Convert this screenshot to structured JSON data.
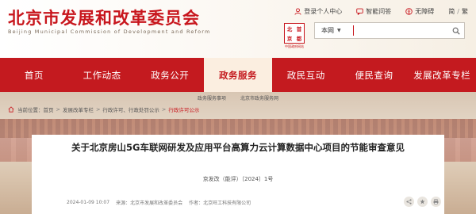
{
  "header": {
    "title": "北京市发展和改革委员会",
    "subtitle": "Beijing Municipal Commission of Development and Reform",
    "top_links": [
      {
        "label": "登录个人中心",
        "icon": "user-icon"
      },
      {
        "label": "智能问答",
        "icon": "chat-icon"
      },
      {
        "label": "无障碍",
        "icon": "accessibility-icon"
      }
    ],
    "lang_simplified": "简",
    "lang_sep": "/",
    "lang_traditional": "繁",
    "seal_chars": [
      "北",
      "首",
      "京",
      "都"
    ],
    "seal_caption": "中国政府网站",
    "search": {
      "scope": "本网",
      "placeholder": "",
      "value": ""
    }
  },
  "nav": {
    "items": [
      {
        "label": "首页"
      },
      {
        "label": "工作动态"
      },
      {
        "label": "政务公开"
      },
      {
        "label": "政务服务",
        "active": true
      },
      {
        "label": "政民互动"
      },
      {
        "label": "便民查询"
      },
      {
        "label": "发展改革专栏"
      }
    ]
  },
  "subnav": {
    "items": [
      "政务服务事项",
      "北京市政务服务网"
    ]
  },
  "breadcrumb": {
    "prefix": "当前位置：",
    "items": [
      "首页",
      "发展改革专栏",
      "行政许可、行政处罚公示",
      "行政许可公示"
    ]
  },
  "article": {
    "title": "关于北京房山5G车联网研发及应用平台高算力云计算数据中心项目的节能审查意见",
    "doc_no": "京发改（能评）〔2024〕1号",
    "date": "2024-01-09 10:07",
    "publisher": "来源：北京市发展和改革委员会",
    "author": "作者：北京旺工科技有限公司"
  },
  "colors": {
    "brand": "#c41a1f",
    "accent": "#c8161d"
  }
}
